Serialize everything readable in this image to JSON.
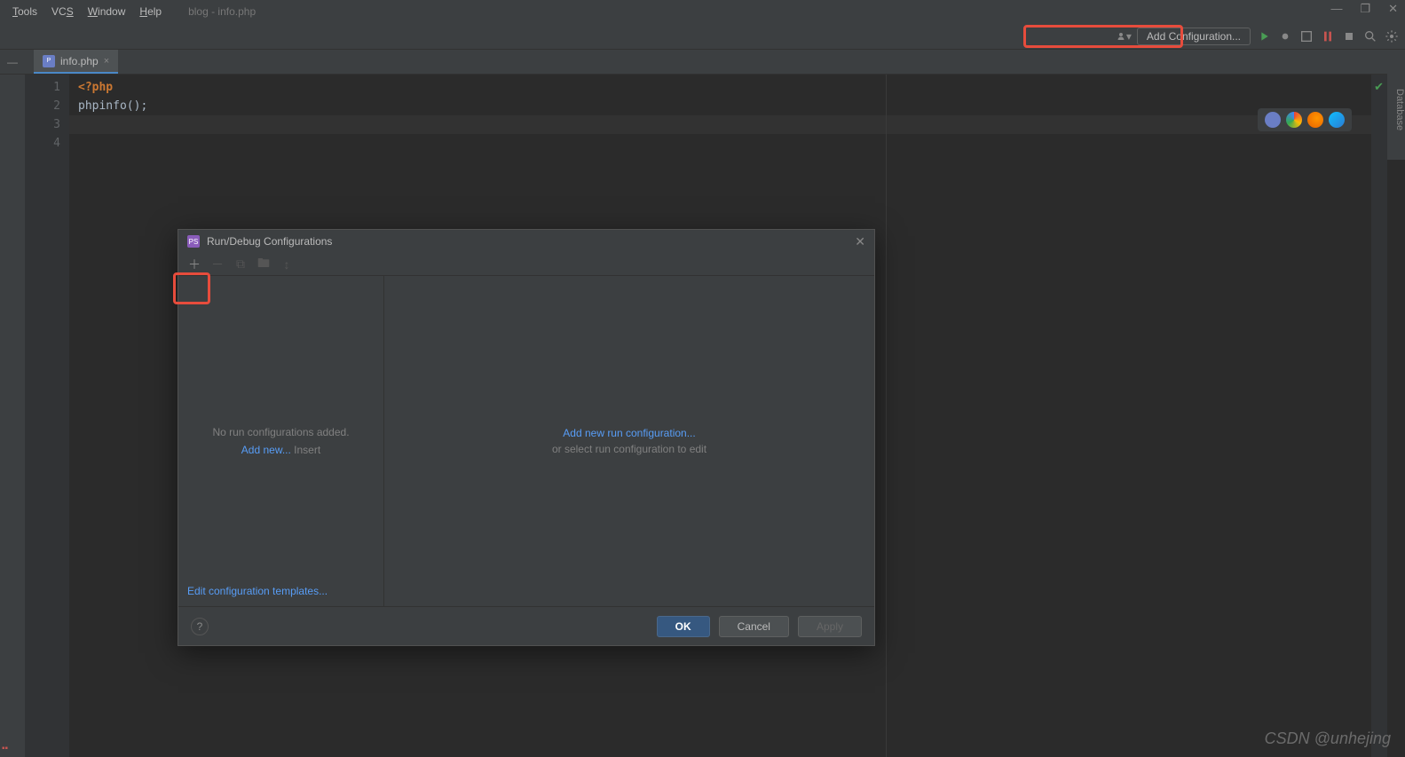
{
  "menubar": {
    "items": [
      "Tools",
      "VCS",
      "Window",
      "Help"
    ],
    "project": "blog - info.php"
  },
  "window_controls": {
    "minimize": "—",
    "maximize": "❐",
    "close": "✕"
  },
  "toolbar": {
    "add_configuration": "Add Configuration..."
  },
  "tabs": {
    "file": "info.php"
  },
  "right_sidebar": {
    "database": "Database"
  },
  "editor": {
    "lines": [
      "1",
      "2",
      "3",
      "4"
    ],
    "code": {
      "l1_open": "<?php",
      "l2_blank": "",
      "l3": "phpinfo();",
      "l4_blank": ""
    }
  },
  "dialog": {
    "title": "Run/Debug Configurations",
    "left": {
      "empty_msg": "No run configurations added.",
      "add_new": "Add new...",
      "insert": " Insert",
      "edit_templates": "Edit configuration templates..."
    },
    "right": {
      "add_link": "Add new run configuration...",
      "sub": "or select run configuration to edit"
    },
    "buttons": {
      "ok": "OK",
      "cancel": "Cancel",
      "apply": "Apply"
    }
  },
  "watermark": "CSDN @unhejing"
}
